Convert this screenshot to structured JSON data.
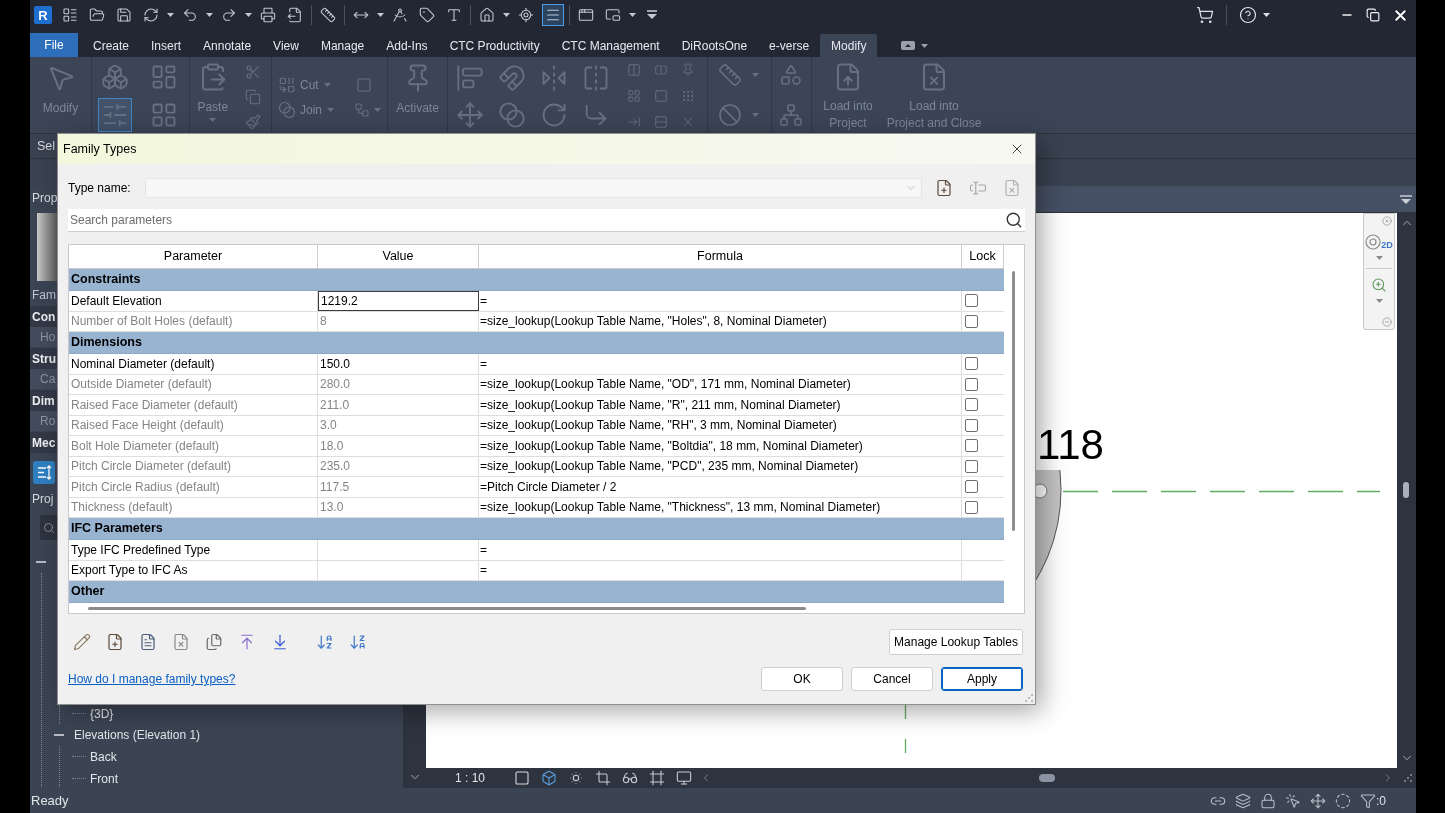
{
  "title_bar": {
    "logo": "R",
    "quick_access": [
      {
        "selected": false
      },
      {
        "selected": false
      },
      {
        "selected": false
      },
      {
        "selected": false
      },
      {
        "selected": false
      },
      {
        "selected": false
      },
      {
        "selected": false
      },
      {
        "selected": false
      },
      {
        "selected": false
      },
      {
        "selected": false
      },
      {
        "selected": false
      },
      {
        "selected": false
      },
      {
        "selected": false
      },
      {
        "selected": false
      },
      {
        "selected": false
      },
      {
        "selected": true
      },
      {
        "selected": false
      },
      {
        "selected": false
      },
      {
        "selected": false
      }
    ]
  },
  "menu_tabs": [
    {
      "label": "File",
      "kind": "application",
      "selected": false
    },
    {
      "label": "Create",
      "kind": "tab",
      "selected": false
    },
    {
      "label": "Insert",
      "kind": "tab",
      "selected": false
    },
    {
      "label": "Annotate",
      "kind": "tab",
      "selected": false
    },
    {
      "label": "View",
      "kind": "tab",
      "selected": false
    },
    {
      "label": "Manage",
      "kind": "tab",
      "selected": false
    },
    {
      "label": "Add-Ins",
      "kind": "tab",
      "selected": false
    },
    {
      "label": "CTC Productivity",
      "kind": "tab",
      "selected": false
    },
    {
      "label": "CTC Management",
      "kind": "tab",
      "selected": false
    },
    {
      "label": "DiRootsOne",
      "kind": "tab",
      "selected": false
    },
    {
      "label": "e-verse",
      "kind": "tab",
      "selected": false
    },
    {
      "label": "Modify",
      "kind": "tab",
      "selected": true
    }
  ],
  "ribbon": {
    "buttons": [
      {
        "label": "Modify"
      },
      {
        "label": "Paste"
      },
      {
        "label": "Cut"
      },
      {
        "label": "Join"
      },
      {
        "label": "Activate"
      },
      {
        "label": "Load into\nProject"
      },
      {
        "label": "Load into\nProject and Close"
      }
    ],
    "family_tools": [
      {
        "selected": false
      },
      {
        "selected": false
      },
      {
        "selected": true
      },
      {
        "selected": false
      }
    ],
    "panel_title": "Sel"
  },
  "properties": {
    "title": "Prop",
    "rows": [
      {
        "kind": "field",
        "label": "Fam"
      },
      {
        "kind": "group",
        "label": "Con"
      },
      {
        "kind": "item",
        "label": "Ho"
      },
      {
        "kind": "group",
        "label": "Stru"
      },
      {
        "kind": "item",
        "label": "Ca"
      },
      {
        "kind": "group",
        "label": "Dim"
      },
      {
        "kind": "item",
        "label": "Ro"
      },
      {
        "kind": "group",
        "label": "Mec"
      }
    ]
  },
  "project_browser": {
    "title": "Proj",
    "tree": [
      {
        "expanded": true,
        "children": [
          {
            "children": [
              {
                "label": "{3D}"
              }
            ]
          },
          {
            "label": "Elevations (Elevation 1)",
            "expanded": true,
            "children": [
              {
                "label": "Back"
              },
              {
                "label": "Front"
              }
            ]
          }
        ]
      }
    ]
  },
  "view": {
    "annotation": "118",
    "navigation_mode": "2D",
    "scale": "1 : 10"
  },
  "status_bar": {
    "message": "Ready",
    "selection_count": ":0"
  },
  "dialog": {
    "title": "Family Types",
    "type_name_label": "Type name:",
    "search_placeholder": "Search parameters",
    "columns": [
      "Parameter",
      "Value",
      "Formula",
      "Lock"
    ],
    "groups": [
      {
        "name": "Constraints",
        "rows": [
          {
            "parameter": "Default Elevation",
            "value": "1219.2",
            "formula": "=",
            "locked": false,
            "disabled": false,
            "editing": true
          },
          {
            "parameter": "Number of Bolt Holes (default)",
            "value": "8",
            "formula": "=size_lookup(Lookup Table Name, \"Holes\", 8, Nominal Diameter)",
            "locked": false,
            "disabled": true,
            "editing": false
          }
        ]
      },
      {
        "name": "Dimensions",
        "rows": [
          {
            "parameter": "Nominal Diameter (default)",
            "value": "150.0",
            "formula": "=",
            "locked": false,
            "disabled": false,
            "editing": false
          },
          {
            "parameter": "Outside Diameter (default)",
            "value": "280.0",
            "formula": "=size_lookup(Lookup Table Name, \"OD\", 171 mm, Nominal Diameter)",
            "locked": false,
            "disabled": true,
            "editing": false
          },
          {
            "parameter": "Raised Face Diameter (default)",
            "value": "211.0",
            "formula": "=size_lookup(Lookup Table Name, \"R\", 211 mm, Nominal Diameter)",
            "locked": false,
            "disabled": true,
            "editing": false
          },
          {
            "parameter": "Raised Face Height (default)",
            "value": "3.0",
            "formula": "=size_lookup(Lookup Table Name, \"RH\", 3 mm, Nominal Diameter)",
            "locked": false,
            "disabled": true,
            "editing": false
          },
          {
            "parameter": "Bolt Hole Diameter (default)",
            "value": "18.0",
            "formula": "=size_lookup(Lookup Table Name, \"Boltdia\", 18 mm, Nominal Diameter)",
            "locked": false,
            "disabled": true,
            "editing": false
          },
          {
            "parameter": "Pitch Circle Diameter (default)",
            "value": "235.0",
            "formula": "=size_lookup(Lookup Table Name, \"PCD\", 235 mm, Nominal Diameter)",
            "locked": false,
            "disabled": true,
            "editing": false
          },
          {
            "parameter": "Pitch Circle Radius (default)",
            "value": "117.5",
            "formula": "=Pitch Circle Diameter / 2",
            "locked": false,
            "disabled": true,
            "editing": false
          },
          {
            "parameter": "Thickness (default)",
            "value": "13.0",
            "formula": "=size_lookup(Lookup Table Name, \"Thickness\", 13 mm, Nominal Diameter)",
            "locked": false,
            "disabled": true,
            "editing": false
          }
        ]
      },
      {
        "name": "IFC Parameters",
        "rows": [
          {
            "parameter": "Type IFC Predefined Type",
            "formula": "=",
            "disabled": false,
            "editing": false
          },
          {
            "parameter": "Export Type to IFC As",
            "formula": "=",
            "disabled": false,
            "editing": false
          }
        ]
      },
      {
        "name": "Other"
      }
    ],
    "manage_button": "Manage Lookup Tables",
    "help_link": "How do I manage family types?",
    "buttons": [
      {
        "label": "OK",
        "default": false
      },
      {
        "label": "Cancel",
        "default": false
      },
      {
        "label": "Apply",
        "default": true
      }
    ]
  }
}
